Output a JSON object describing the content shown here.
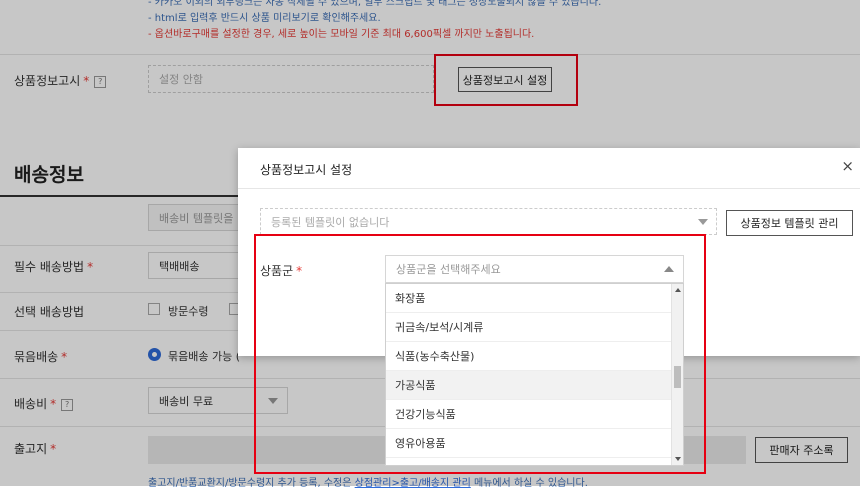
{
  "notices": {
    "line1": "- 카카오 이외의 외부링크는 자동 삭제될 수 있으며, 일부 스크립트 및 태그는 정상노출되지 않을 수 있습니다.",
    "line2": "- html로 입력후 반드시 상품 미리보기로 확인해주세요.",
    "line3": "- 옵션바로구매를 설정한 경우, 세로 높이는 모바일 기준 최대 6,600픽셀 까지만 노출됩니다."
  },
  "product_info": {
    "label": "상품정보고시",
    "required_mark": "*",
    "help_icon": "?",
    "status": "설정 안함",
    "button": "상품정보고시 설정"
  },
  "shipping": {
    "section_title": "배송정보",
    "template_placeholder": "배송비 템플릿을",
    "required_method_label": "필수 배송방법",
    "required_method_value": "택배배송",
    "optional_method_label": "선택 배송방법",
    "optional_method_option": "방문수령",
    "bundle_label": "묶음배송",
    "bundle_option": "묶음배송 가능 (",
    "fee_label": "배송비",
    "fee_value": "배송비 무료",
    "origin_label": "출고지",
    "seller_address_button": "판매자 주소록",
    "footer_note_prefix": "출고지/반품교환지/방문수령지 추가 등록, 수정은 ",
    "footer_note_link": "상점관리>출고/배송지 관리",
    "footer_note_suffix": " 메뉴에서 하실 수 있습니다."
  },
  "modal": {
    "title": "상품정보고시 설정",
    "close_icon": "×",
    "template_placeholder": "등록된 템플릿이 없습니다",
    "template_manage_button": "상품정보 템플릿 관리",
    "category_label": "상품군",
    "required_mark": "*",
    "category_placeholder": "상품군을 선택해주세요"
  },
  "dropdown": {
    "items": [
      "화장품",
      "귀금속/보석/시계류",
      "식품(농수축산물)",
      "가공식품",
      "건강기능식품",
      "영유아용품"
    ],
    "hover_index": 3
  },
  "colors": {
    "highlight": "#e60012",
    "required": "#e53935",
    "notice_blue": "#3b6db5",
    "link": "#2f6bd8"
  }
}
